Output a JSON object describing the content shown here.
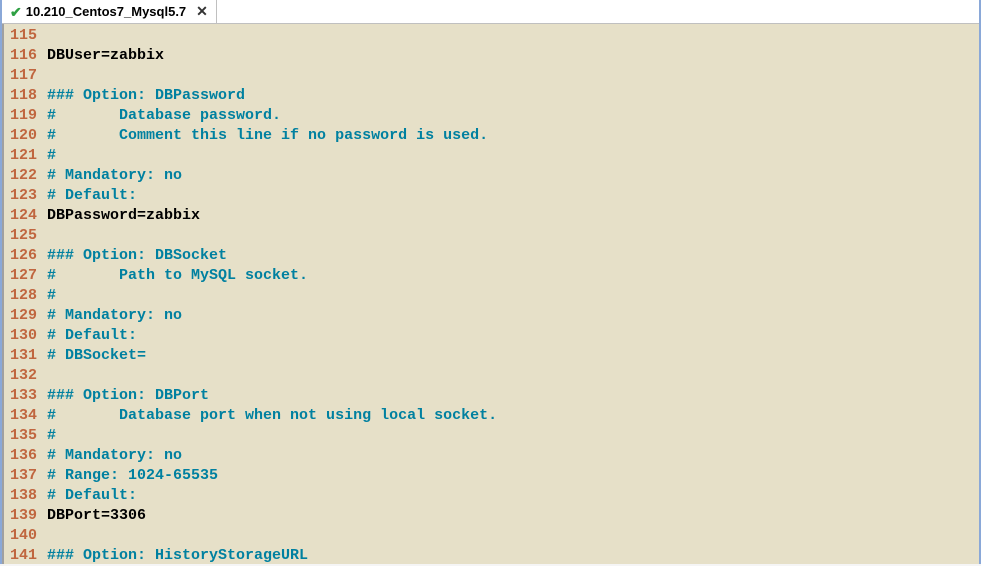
{
  "tab": {
    "title": "10.210_Centos7_Mysql5.7",
    "close": "✕"
  },
  "lines": [
    {
      "num": "115",
      "text": "",
      "klass": "c-plain"
    },
    {
      "num": "116",
      "text": "DBUser=zabbix",
      "klass": "c-plain"
    },
    {
      "num": "117",
      "text": "",
      "klass": "c-plain"
    },
    {
      "num": "118",
      "text": "### Option: DBPassword",
      "klass": "c-comment"
    },
    {
      "num": "119",
      "text": "#       Database password.",
      "klass": "c-comment"
    },
    {
      "num": "120",
      "text": "#       Comment this line if no password is used.",
      "klass": "c-comment"
    },
    {
      "num": "121",
      "text": "#",
      "klass": "c-comment"
    },
    {
      "num": "122",
      "text": "# Mandatory: no",
      "klass": "c-comment"
    },
    {
      "num": "123",
      "text": "# Default:",
      "klass": "c-comment"
    },
    {
      "num": "124",
      "text": "DBPassword=zabbix",
      "klass": "c-plain"
    },
    {
      "num": "125",
      "text": "",
      "klass": "c-plain"
    },
    {
      "num": "126",
      "text": "### Option: DBSocket",
      "klass": "c-comment"
    },
    {
      "num": "127",
      "text": "#       Path to MySQL socket.",
      "klass": "c-comment"
    },
    {
      "num": "128",
      "text": "#",
      "klass": "c-comment"
    },
    {
      "num": "129",
      "text": "# Mandatory: no",
      "klass": "c-comment"
    },
    {
      "num": "130",
      "text": "# Default:",
      "klass": "c-comment"
    },
    {
      "num": "131",
      "text": "# DBSocket=",
      "klass": "c-comment"
    },
    {
      "num": "132",
      "text": "",
      "klass": "c-plain"
    },
    {
      "num": "133",
      "text": "### Option: DBPort",
      "klass": "c-comment"
    },
    {
      "num": "134",
      "text": "#       Database port when not using local socket.",
      "klass": "c-comment"
    },
    {
      "num": "135",
      "text": "#",
      "klass": "c-comment"
    },
    {
      "num": "136",
      "text": "# Mandatory: no",
      "klass": "c-comment"
    },
    {
      "num": "137",
      "text": "# Range: 1024-65535",
      "klass": "c-comment"
    },
    {
      "num": "138",
      "text": "# Default:",
      "klass": "c-comment"
    },
    {
      "num": "139",
      "text": "DBPort=3306",
      "klass": "c-plain"
    },
    {
      "num": "140",
      "text": "",
      "klass": "c-plain"
    },
    {
      "num": "141",
      "text": "### Option: HistoryStorageURL",
      "klass": "c-comment"
    }
  ]
}
